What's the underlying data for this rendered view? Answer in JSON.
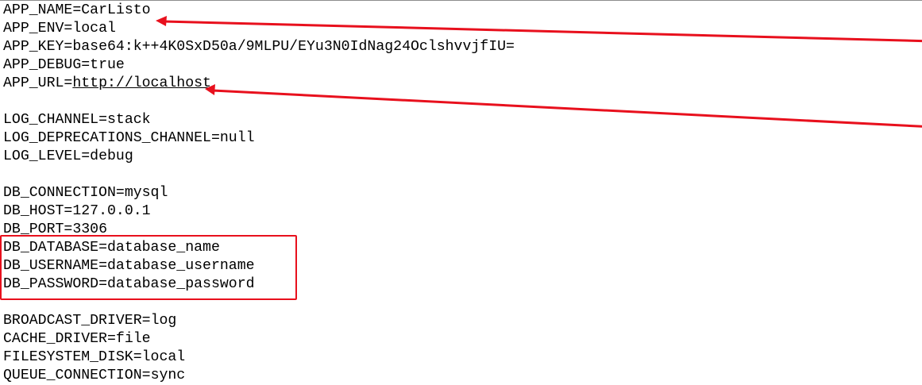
{
  "env_file": {
    "lines": [
      {
        "key": "APP_NAME",
        "value": "CarListo"
      },
      {
        "key": "APP_ENV",
        "value": "local"
      },
      {
        "key": "APP_KEY",
        "value": "base64:k++4K0SxD50a/9MLPU/EYu3N0IdNag24OclshvvjfIU="
      },
      {
        "key": "APP_DEBUG",
        "value": "true"
      },
      {
        "key": "APP_URL",
        "value": "http://localhost",
        "is_link": true
      },
      {
        "blank": true
      },
      {
        "key": "LOG_CHANNEL",
        "value": "stack"
      },
      {
        "key": "LOG_DEPRECATIONS_CHANNEL",
        "value": "null"
      },
      {
        "key": "LOG_LEVEL",
        "value": "debug"
      },
      {
        "blank": true
      },
      {
        "key": "DB_CONNECTION",
        "value": "mysql"
      },
      {
        "key": "DB_HOST",
        "value": "127.0.0.1"
      },
      {
        "key": "DB_PORT",
        "value": "3306"
      },
      {
        "key": "DB_DATABASE",
        "value": "database_name"
      },
      {
        "key": "DB_USERNAME",
        "value": "database_username"
      },
      {
        "key": "DB_PASSWORD",
        "value": "database_password"
      },
      {
        "blank": true
      },
      {
        "key": "BROADCAST_DRIVER",
        "value": "log"
      },
      {
        "key": "CACHE_DRIVER",
        "value": "file"
      },
      {
        "key": "FILESYSTEM_DISK",
        "value": "local"
      },
      {
        "key": "QUEUE_CONNECTION",
        "value": "sync"
      }
    ]
  },
  "annotations": {
    "color": "#e8101d",
    "highlight_box": "database-credentials",
    "arrows": [
      "app-name-arrow",
      "app-url-arrow"
    ]
  }
}
